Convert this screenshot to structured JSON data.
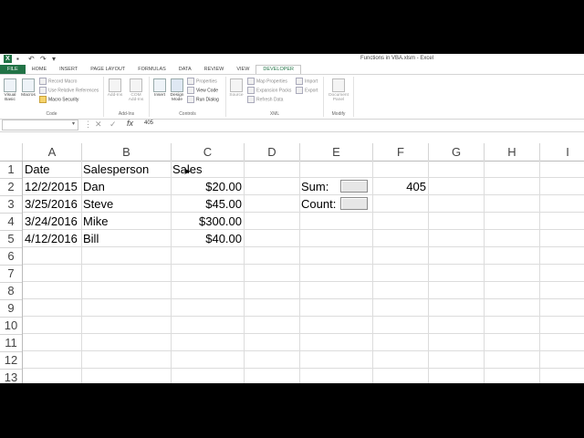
{
  "window": {
    "title": "Functions in VBA.xlsm - Excel"
  },
  "tabs": [
    "FILE",
    "HOME",
    "INSERT",
    "PAGE LAYOUT",
    "FORMULAS",
    "DATA",
    "REVIEW",
    "VIEW",
    "DEVELOPER"
  ],
  "active_tab": "DEVELOPER",
  "ribbon": {
    "code": {
      "label": "Code",
      "visual_basic": "Visual Basic",
      "macros": "Macros",
      "record_macro": "Record Macro",
      "use_relative": "Use Relative References",
      "macro_security": "Macro Security"
    },
    "addins": {
      "label": "Add-Ins",
      "addins_btn": "Add-Ins",
      "com_addins": "COM Add-Ins"
    },
    "controls": {
      "label": "Controls",
      "insert": "Insert",
      "design_mode": "Design Mode",
      "properties": "Properties",
      "view_code": "View Code",
      "run_dialog": "Run Dialog"
    },
    "xml": {
      "label": "XML",
      "source": "Source",
      "map_properties": "Map Properties",
      "expansion_packs": "Expansion Packs",
      "refresh_data": "Refresh Data",
      "import": "Import",
      "export": "Export"
    },
    "modify": {
      "label": "Modify",
      "document_panel": "Document Panel"
    }
  },
  "formula_bar": {
    "name_box": "",
    "fx": "fx",
    "value": "405"
  },
  "columns": [
    "A",
    "B",
    "C",
    "D",
    "E",
    "F",
    "G",
    "H",
    "I"
  ],
  "rows": [
    "1",
    "2",
    "3",
    "4",
    "5",
    "6",
    "7",
    "8",
    "9",
    "10",
    "11",
    "12",
    "13"
  ],
  "sheet": {
    "headers": {
      "A": "Date",
      "B": "Salesperson",
      "C": "Sales"
    },
    "data": [
      {
        "date": "12/2/2015",
        "person": "Dan",
        "sales": "$20.00"
      },
      {
        "date": "3/25/2016",
        "person": "Steve",
        "sales": "$45.00"
      },
      {
        "date": "3/24/2016",
        "person": "Mike",
        "sales": "$300.00"
      },
      {
        "date": "4/12/2016",
        "person": "Bill",
        "sales": "$40.00"
      }
    ],
    "sum_label": "Sum:",
    "count_label": "Count:",
    "sum_value": "405"
  },
  "colors": {
    "excel_green": "#217346",
    "gridline": "#dcdcdc"
  }
}
